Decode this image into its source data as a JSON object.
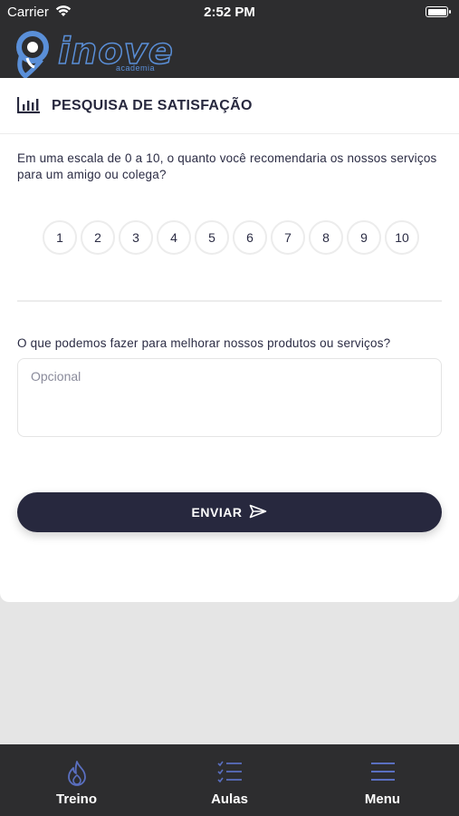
{
  "status_bar": {
    "carrier": "Carrier",
    "time": "2:52 PM",
    "icons": [
      "wifi-icon",
      "battery-icon"
    ]
  },
  "header": {
    "logo_text": "inove",
    "logo_subtext": "academia",
    "accent_color": "#5a8fd8",
    "background_color": "#2d2d2f"
  },
  "survey": {
    "title": "PESQUISA DE SATISFAÇÃO",
    "title_icon": "bar-chart-icon",
    "question_nps": "Em uma escala de 0 a 10, o quanto você recomendaria os nossos serviços para um amigo ou colega?",
    "scale": [
      "1",
      "2",
      "3",
      "4",
      "5",
      "6",
      "7",
      "8",
      "9",
      "10"
    ],
    "question_improve": "O que podemos fazer para melhorar nossos produtos ou serviços?",
    "comment_value": "",
    "comment_placeholder": "Opcional",
    "submit_label": "ENVIAR",
    "submit_icon": "send-icon",
    "primary_color": "#27283e"
  },
  "tab_bar": {
    "tabs": [
      {
        "label": "Treino",
        "icon": "flame-icon"
      },
      {
        "label": "Aulas",
        "icon": "checklist-icon"
      },
      {
        "label": "Menu",
        "icon": "hamburger-menu-icon"
      }
    ],
    "icon_color": "#5a6fc0"
  }
}
